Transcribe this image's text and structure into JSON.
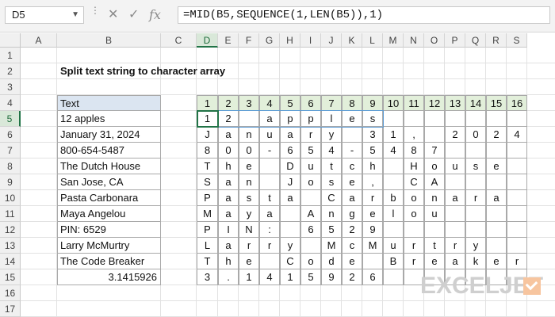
{
  "formula_bar": {
    "name_box": "D5",
    "formula": "=MID(B5,SEQUENCE(1,LEN(B5)),1)",
    "icons": [
      "chevron-down-icon",
      "cancel-icon",
      "confirm-icon",
      "fx-icon"
    ]
  },
  "columns": [
    "A",
    "B",
    "C",
    "D",
    "E",
    "F",
    "G",
    "H",
    "I",
    "J",
    "K",
    "L",
    "M",
    "N",
    "O",
    "P",
    "Q",
    "R",
    "S"
  ],
  "rows": [
    "1",
    "2",
    "3",
    "4",
    "5",
    "6",
    "7",
    "8",
    "9",
    "10",
    "11",
    "12",
    "13",
    "14",
    "15",
    "16",
    "17"
  ],
  "selected_cell": {
    "column": "D",
    "row": "5"
  },
  "title": "Split text string to character array",
  "text_column": {
    "header": "Text",
    "values": [
      "12 apples",
      "January 31, 2024",
      "800-654-5487",
      "The Dutch House",
      "San Jose, CA",
      "Pasta Carbonara",
      "Maya Angelou",
      "PIN: 6529",
      "Larry McMurtry",
      "The Code Breaker",
      "3.1415926"
    ]
  },
  "array_headers": [
    "1",
    "2",
    "3",
    "4",
    "5",
    "6",
    "7",
    "8",
    "9",
    "10",
    "11",
    "12",
    "13",
    "14",
    "15",
    "16"
  ],
  "array_rows": [
    [
      "1",
      "2",
      " ",
      "a",
      "p",
      "p",
      "l",
      "e",
      "s",
      "",
      "",
      "",
      "",
      "",
      "",
      ""
    ],
    [
      "J",
      "a",
      "n",
      "u",
      "a",
      "r",
      "y",
      " ",
      "3",
      "1",
      ",",
      " ",
      "2",
      "0",
      "2",
      "4"
    ],
    [
      "8",
      "0",
      "0",
      "-",
      "6",
      "5",
      "4",
      "-",
      "5",
      "4",
      "8",
      "7",
      "",
      "",
      "",
      ""
    ],
    [
      "T",
      "h",
      "e",
      " ",
      "D",
      "u",
      "t",
      "c",
      "h",
      " ",
      "H",
      "o",
      "u",
      "s",
      "e",
      ""
    ],
    [
      "S",
      "a",
      "n",
      " ",
      "J",
      "o",
      "s",
      "e",
      ",",
      " ",
      "C",
      "A",
      "",
      "",
      "",
      ""
    ],
    [
      "P",
      "a",
      "s",
      "t",
      "a",
      " ",
      "C",
      "a",
      "r",
      "b",
      "o",
      "n",
      "a",
      "r",
      "a",
      ""
    ],
    [
      "M",
      "a",
      "y",
      "a",
      " ",
      "A",
      "n",
      "g",
      "e",
      "l",
      "o",
      "u",
      "",
      "",
      "",
      ""
    ],
    [
      "P",
      "I",
      "N",
      ":",
      " ",
      "6",
      "5",
      "2",
      "9",
      "",
      "",
      "",
      "",
      "",
      "",
      ""
    ],
    [
      "L",
      "a",
      "r",
      "r",
      "y",
      " ",
      "M",
      "c",
      "M",
      "u",
      "r",
      "t",
      "r",
      "y",
      "",
      ""
    ],
    [
      "T",
      "h",
      "e",
      " ",
      "C",
      "o",
      "d",
      "e",
      " ",
      "B",
      "r",
      "e",
      "a",
      "k",
      "e",
      "r"
    ],
    [
      "3",
      ".",
      "1",
      "4",
      "1",
      "5",
      "9",
      "2",
      "6",
      "",
      "",
      "",
      "",
      "",
      "",
      ""
    ]
  ],
  "logo": {
    "text": "EXCELJET"
  },
  "colors": {
    "accent": "#217346",
    "text_header_fill": "#dbe5f1",
    "array_header_fill": "#e2efda",
    "spill_border": "#5b9bd5"
  }
}
